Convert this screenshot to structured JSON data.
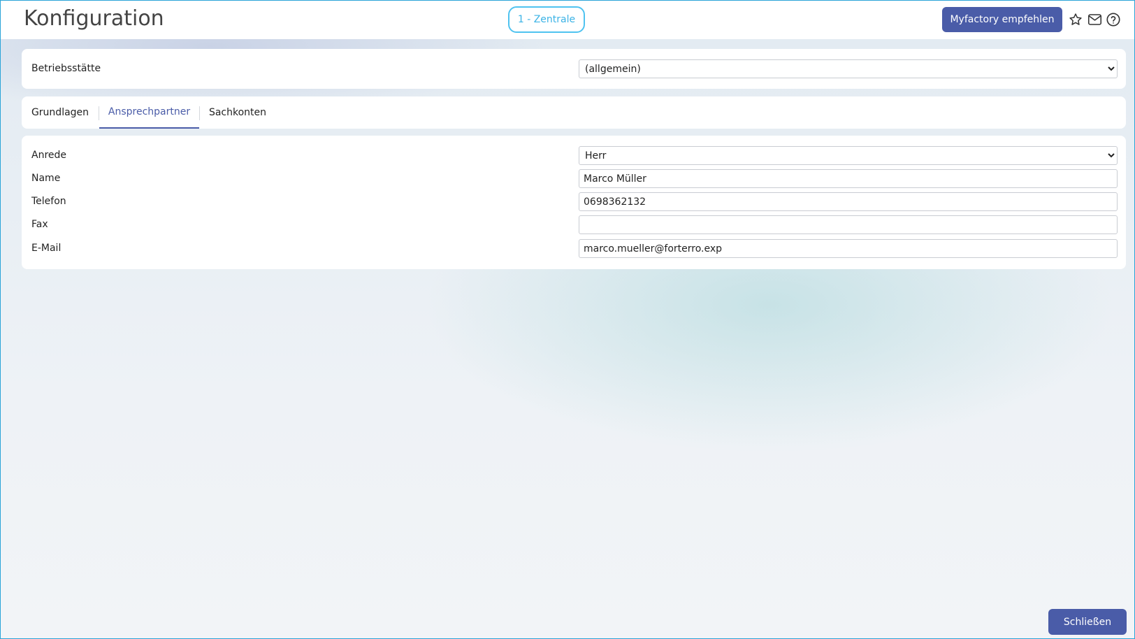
{
  "header": {
    "title": "Konfiguration",
    "company_badge": "1 - Zentrale",
    "recommend_label": "Myfactory empfehlen",
    "icons": [
      "star-icon",
      "mail-icon",
      "help-icon"
    ]
  },
  "site": {
    "label": "Betriebsstätte",
    "selected": "(allgemein)"
  },
  "tabs": [
    {
      "label": "Grundlagen",
      "active": false
    },
    {
      "label": "Ansprechpartner",
      "active": true
    },
    {
      "label": "Sachkonten",
      "active": false
    }
  ],
  "contact": {
    "salutation_label": "Anrede",
    "salutation_value": "Herr",
    "name_label": "Name",
    "name_value": "Marco Müller",
    "phone_label": "Telefon",
    "phone_value": "0698362132",
    "fax_label": "Fax",
    "fax_value": "",
    "email_label": "E-Mail",
    "email_value": "marco.mueller@forterro.exp"
  },
  "footer": {
    "close_label": "Schließen"
  },
  "colors": {
    "accent": "#4a5ca8",
    "badge": "#4fc3f0",
    "frame": "#2aa4d8"
  }
}
